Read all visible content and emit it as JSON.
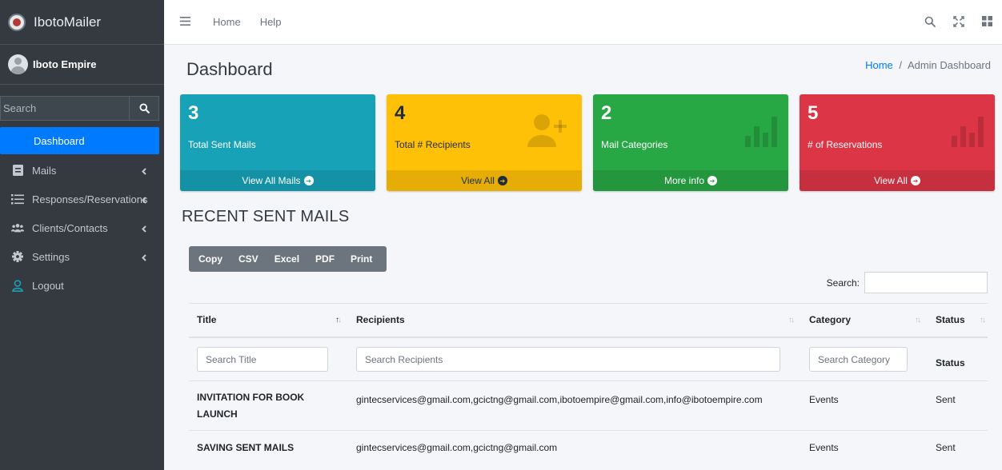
{
  "app": {
    "brand": "IbotoMailer",
    "user": "Iboto Empire"
  },
  "sidebar": {
    "search_placeholder": "Search",
    "items": [
      {
        "label": "Dashboard"
      },
      {
        "label": "Mails"
      },
      {
        "label": "Responses/Reservations"
      },
      {
        "label": "Clients/Contacts"
      },
      {
        "label": "Settings"
      },
      {
        "label": "Logout"
      }
    ]
  },
  "topbar": {
    "links": [
      "Home",
      "Help"
    ]
  },
  "page": {
    "title": "Dashboard",
    "breadcrumb": {
      "home": "Home",
      "sep": "/",
      "current": "Admin Dashboard"
    }
  },
  "stats": [
    {
      "value": "3",
      "label": "Total Sent Mails",
      "link": "View All Mails",
      "color": "#17a2b8",
      "footer_color": "#1591a5"
    },
    {
      "value": "4",
      "label": "Total # Recipients",
      "link": "View All",
      "color": "#ffc107",
      "footer_color": "#e5ad06"
    },
    {
      "value": "2",
      "label": "Mail Categories",
      "link": "More info",
      "color": "#28a745",
      "footer_color": "#24963e"
    },
    {
      "value": "5",
      "label": "# of Reservations",
      "link": "View All",
      "color": "#dc3545",
      "footer_color": "#c62f3e"
    }
  ],
  "recent": {
    "title": "RECENT SENT MAILS",
    "buttons": [
      "Copy",
      "CSV",
      "Excel",
      "PDF",
      "Print"
    ],
    "search_label": "Search:",
    "columns": [
      "Title",
      "Recipients",
      "Category",
      "Status"
    ],
    "filters": [
      "Search Title",
      "Search Recipients",
      "Search Category",
      "Status"
    ],
    "rows": [
      {
        "title": "INVITATION FOR BOOK LAUNCH",
        "recipients": "gintecservices@gmail.com,gcictng@gmail.com,ibotoempire@gmail.com,info@ibotoempire.com",
        "category": "Events",
        "status": "Sent"
      },
      {
        "title": "SAVING SENT MAILS",
        "recipients": "gintecservices@gmail.com,gcictng@gmail.com",
        "category": "Events",
        "status": "Sent"
      }
    ]
  }
}
